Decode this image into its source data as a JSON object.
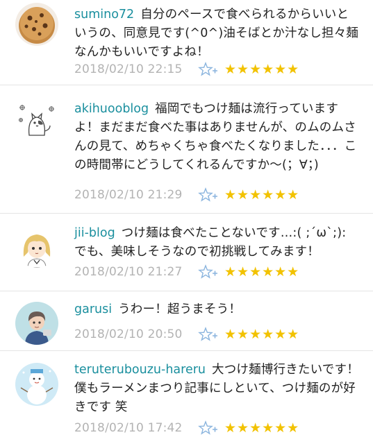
{
  "comments": [
    {
      "user": "sumino72",
      "text": "自分のペースで食べられるからいいというの、同意見です(^0^)油そばとか汁なし担々麺なんかもいいですよね！",
      "date": "2018/02/10 22:15",
      "stars": "★★★★★★",
      "avatar_icon": "cookie-avatar-icon"
    },
    {
      "user": "akihuooblog",
      "text": "福岡でもつけ麺は流行っていますよ！まだまだ食べた事はありませんが、のムのムさんの見て、めちゃくちゃ食べたくなりました．．．この時間帯にどうしてくれるんですか～(；∀；)",
      "date": "2018/02/10 21:29",
      "stars": "★★★★★★",
      "avatar_icon": "cat-sketch-avatar-icon"
    },
    {
      "user": "jii-blog",
      "text": "つけ麺は食べたことないです…:( ;´ω`;): でも、美味しそうなので初挑戦してみます！",
      "date": "2018/02/10 21:27",
      "stars": "★★★★★★",
      "avatar_icon": "anime-girl-avatar-icon"
    },
    {
      "user": "garusi",
      "text": "うわー！超うまそう！",
      "date": "2018/02/10 20:50",
      "stars": "★★★★★★",
      "avatar_icon": "person-illustration-avatar-icon"
    },
    {
      "user": "teruterubouzu-hareru",
      "text": "大つけ麺博行きたいです！僕もラーメンまつり記事にしといて、つけ麺のが好きです 笑",
      "date": "2018/02/10 17:42",
      "stars": "★★★★★★",
      "avatar_icon": "snowman-avatar-icon"
    }
  ],
  "add_star_icon": "add-star-icon",
  "colors": {
    "username": "#1a8f9e",
    "date": "#b3b3b3",
    "star": "#f2c200",
    "add_star": "#8ab4de"
  }
}
